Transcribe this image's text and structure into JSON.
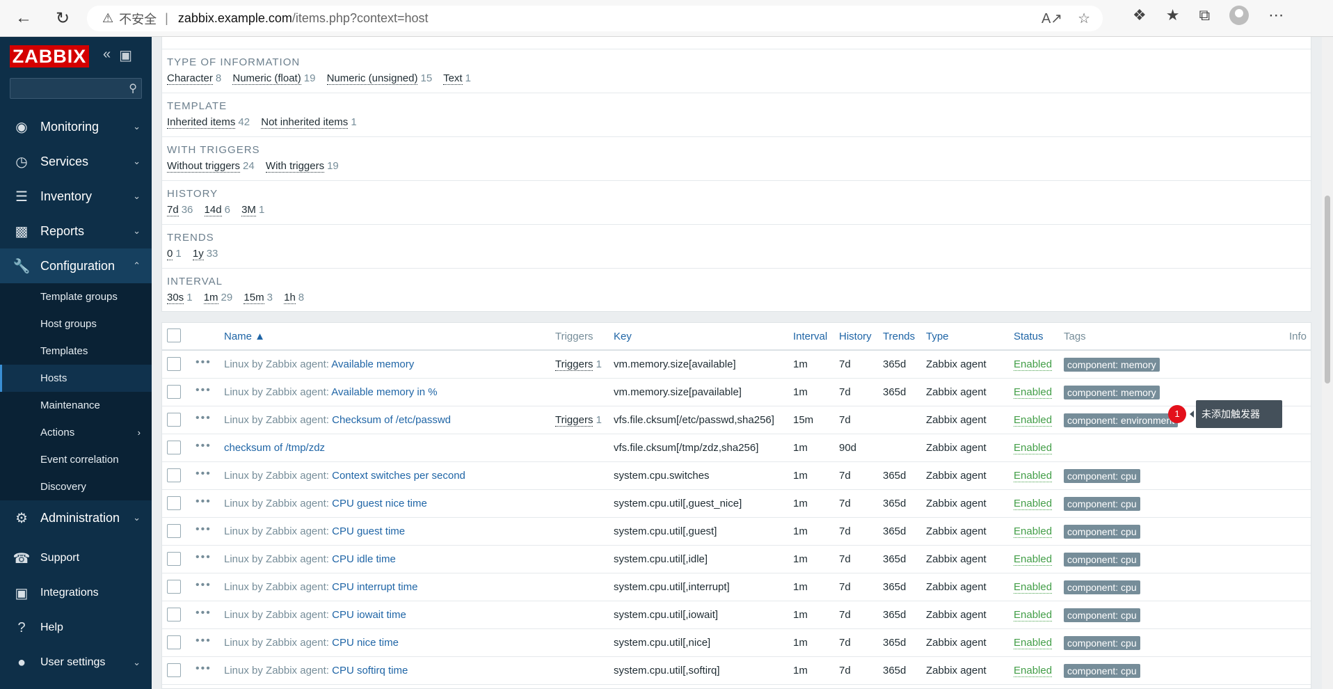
{
  "browser": {
    "insecure_label": "不安全",
    "url_host": "zabbix.example.com",
    "url_path": "/items.php?context=host"
  },
  "sidebar": {
    "logo": "ZABBIX",
    "menu": [
      {
        "label": "Monitoring"
      },
      {
        "label": "Services"
      },
      {
        "label": "Inventory"
      },
      {
        "label": "Reports"
      },
      {
        "label": "Configuration"
      }
    ],
    "configuration_sub": [
      {
        "label": "Template groups"
      },
      {
        "label": "Host groups"
      },
      {
        "label": "Templates"
      },
      {
        "label": "Hosts"
      },
      {
        "label": "Maintenance"
      },
      {
        "label": "Actions"
      },
      {
        "label": "Event correlation"
      },
      {
        "label": "Discovery"
      }
    ],
    "administration": "Administration",
    "bottom": [
      {
        "label": "Support"
      },
      {
        "label": "Integrations"
      },
      {
        "label": "Help"
      },
      {
        "label": "User settings"
      }
    ]
  },
  "filter": {
    "type_of_information": {
      "title": "TYPE OF INFORMATION",
      "values": [
        {
          "label": "Character",
          "count": "8"
        },
        {
          "label": "Numeric (float)",
          "count": "19"
        },
        {
          "label": "Numeric (unsigned)",
          "count": "15"
        },
        {
          "label": "Text",
          "count": "1"
        }
      ]
    },
    "template": {
      "title": "TEMPLATE",
      "values": [
        {
          "label": "Inherited items",
          "count": "42"
        },
        {
          "label": "Not inherited items",
          "count": "1"
        }
      ]
    },
    "with_triggers": {
      "title": "WITH TRIGGERS",
      "values": [
        {
          "label": "Without triggers",
          "count": "24"
        },
        {
          "label": "With triggers",
          "count": "19"
        }
      ]
    },
    "history": {
      "title": "HISTORY",
      "values": [
        {
          "label": "7d",
          "count": "36"
        },
        {
          "label": "14d",
          "count": "6"
        },
        {
          "label": "3M",
          "count": "1"
        }
      ]
    },
    "trends": {
      "title": "TRENDS",
      "values": [
        {
          "label": "0",
          "count": "1"
        },
        {
          "label": "1y",
          "count": "33"
        }
      ]
    },
    "interval": {
      "title": "INTERVAL",
      "values": [
        {
          "label": "30s",
          "count": "1"
        },
        {
          "label": "1m",
          "count": "29"
        },
        {
          "label": "15m",
          "count": "3"
        },
        {
          "label": "1h",
          "count": "8"
        }
      ]
    }
  },
  "table": {
    "headers": {
      "name": "Name ▲",
      "triggers": "Triggers",
      "key": "Key",
      "interval": "Interval",
      "history": "History",
      "trends": "Trends",
      "type": "Type",
      "status": "Status",
      "tags": "Tags",
      "info": "Info"
    },
    "rows": [
      {
        "prefix": "Linux by Zabbix agent: ",
        "name": "Available memory",
        "triggers": "Triggers",
        "trig_count": "1",
        "key": "vm.memory.size[available]",
        "interval": "1m",
        "history": "7d",
        "trends": "365d",
        "type": "Zabbix agent",
        "status": "Enabled",
        "tag": "component: memory"
      },
      {
        "prefix": "Linux by Zabbix agent: ",
        "name": "Available memory in %",
        "triggers": "",
        "trig_count": "",
        "key": "vm.memory.size[pavailable]",
        "interval": "1m",
        "history": "7d",
        "trends": "365d",
        "type": "Zabbix agent",
        "status": "Enabled",
        "tag": "component: memory"
      },
      {
        "prefix": "Linux by Zabbix agent: ",
        "name": "Checksum of /etc/passwd",
        "triggers": "Triggers",
        "trig_count": "1",
        "key": "vfs.file.cksum[/etc/passwd,sha256]",
        "interval": "15m",
        "history": "7d",
        "trends": "",
        "type": "Zabbix agent",
        "status": "Enabled",
        "tag": "component: environment"
      },
      {
        "prefix": "",
        "name": "checksum of /tmp/zdz",
        "triggers": "",
        "trig_count": "",
        "key": "vfs.file.cksum[/tmp/zdz,sha256]",
        "interval": "1m",
        "history": "90d",
        "trends": "",
        "type": "Zabbix agent",
        "status": "Enabled",
        "tag": ""
      },
      {
        "prefix": "Linux by Zabbix agent: ",
        "name": "Context switches per second",
        "triggers": "",
        "trig_count": "",
        "key": "system.cpu.switches",
        "interval": "1m",
        "history": "7d",
        "trends": "365d",
        "type": "Zabbix agent",
        "status": "Enabled",
        "tag": "component: cpu"
      },
      {
        "prefix": "Linux by Zabbix agent: ",
        "name": "CPU guest nice time",
        "triggers": "",
        "trig_count": "",
        "key": "system.cpu.util[,guest_nice]",
        "interval": "1m",
        "history": "7d",
        "trends": "365d",
        "type": "Zabbix agent",
        "status": "Enabled",
        "tag": "component: cpu"
      },
      {
        "prefix": "Linux by Zabbix agent: ",
        "name": "CPU guest time",
        "triggers": "",
        "trig_count": "",
        "key": "system.cpu.util[,guest]",
        "interval": "1m",
        "history": "7d",
        "trends": "365d",
        "type": "Zabbix agent",
        "status": "Enabled",
        "tag": "component: cpu"
      },
      {
        "prefix": "Linux by Zabbix agent: ",
        "name": "CPU idle time",
        "triggers": "",
        "trig_count": "",
        "key": "system.cpu.util[,idle]",
        "interval": "1m",
        "history": "7d",
        "trends": "365d",
        "type": "Zabbix agent",
        "status": "Enabled",
        "tag": "component: cpu"
      },
      {
        "prefix": "Linux by Zabbix agent: ",
        "name": "CPU interrupt time",
        "triggers": "",
        "trig_count": "",
        "key": "system.cpu.util[,interrupt]",
        "interval": "1m",
        "history": "7d",
        "trends": "365d",
        "type": "Zabbix agent",
        "status": "Enabled",
        "tag": "component: cpu"
      },
      {
        "prefix": "Linux by Zabbix agent: ",
        "name": "CPU iowait time",
        "triggers": "",
        "trig_count": "",
        "key": "system.cpu.util[,iowait]",
        "interval": "1m",
        "history": "7d",
        "trends": "365d",
        "type": "Zabbix agent",
        "status": "Enabled",
        "tag": "component: cpu"
      },
      {
        "prefix": "Linux by Zabbix agent: ",
        "name": "CPU nice time",
        "triggers": "",
        "trig_count": "",
        "key": "system.cpu.util[,nice]",
        "interval": "1m",
        "history": "7d",
        "trends": "365d",
        "type": "Zabbix agent",
        "status": "Enabled",
        "tag": "component: cpu"
      },
      {
        "prefix": "Linux by Zabbix agent: ",
        "name": "CPU softirq time",
        "triggers": "",
        "trig_count": "",
        "key": "system.cpu.util[,softirq]",
        "interval": "1m",
        "history": "7d",
        "trends": "365d",
        "type": "Zabbix agent",
        "status": "Enabled",
        "tag": "component: cpu"
      }
    ],
    "info_badge": "1",
    "tooltip": "未添加触发器"
  }
}
